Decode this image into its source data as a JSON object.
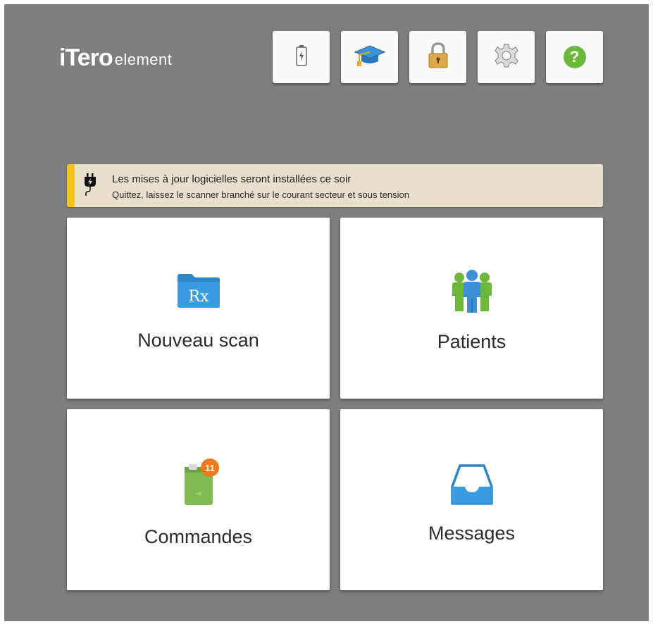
{
  "brand": {
    "logo_main": "iTero",
    "logo_sub": "element"
  },
  "toolbar": [
    {
      "name": "battery",
      "icon": "battery-charging-icon"
    },
    {
      "name": "training",
      "icon": "graduation-cap-icon"
    },
    {
      "name": "lock",
      "icon": "padlock-icon"
    },
    {
      "name": "settings",
      "icon": "gear-icon"
    },
    {
      "name": "help",
      "icon": "help-question-icon",
      "label": "?"
    }
  ],
  "notification": {
    "icon": "power-plug-icon",
    "title": "Les mises à jour logicielles seront installées ce soir",
    "message": "Quittez, laissez le scanner branché sur le courant secteur et sous tension",
    "accent_color": "#f4c21c"
  },
  "tiles": {
    "new_scan": {
      "label": "Nouveau scan",
      "icon": "rx-folder-icon",
      "folder_text": "Rx"
    },
    "patients": {
      "label": "Patients",
      "icon": "patients-group-icon"
    },
    "orders": {
      "label": "Commandes",
      "icon": "orders-clipboard-icon",
      "badge_count": "11"
    },
    "messages": {
      "label": "Messages",
      "icon": "inbox-tray-icon"
    }
  },
  "colors": {
    "background": "#7e7e7e",
    "folder_blue": "#3a95d6",
    "people_green": "#6cb83a",
    "orders_green": "#7fba52",
    "badge_orange": "#ee7a1c"
  }
}
